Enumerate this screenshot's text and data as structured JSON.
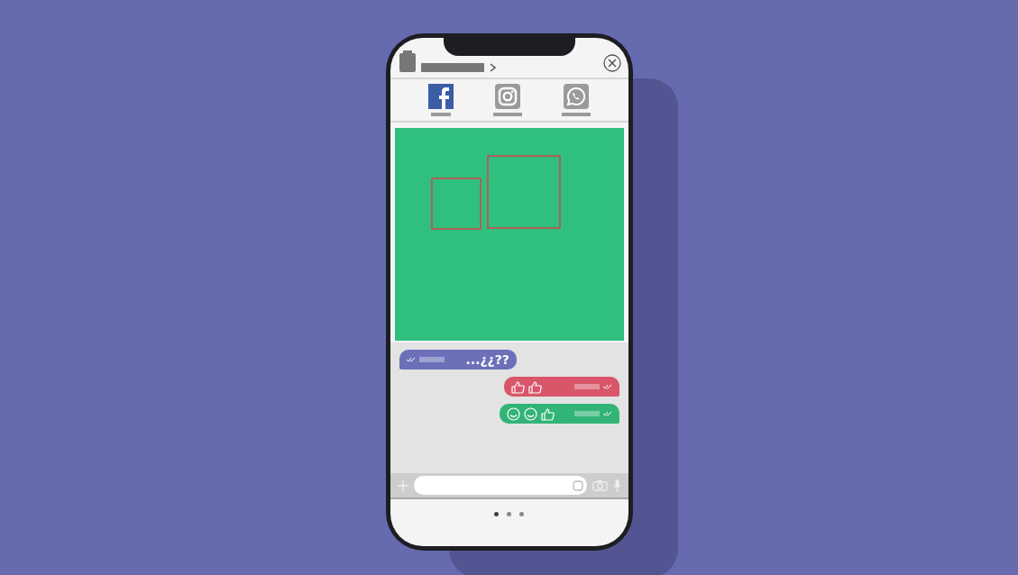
{
  "tabs": [
    {
      "kind": "facebook",
      "selected": true
    },
    {
      "kind": "instagram",
      "selected": false
    },
    {
      "kind": "whatsapp",
      "selected": false
    }
  ],
  "messages": [
    {
      "outgoing": false,
      "color": "#6b70b9",
      "kind": "text",
      "text": "...¿¿??"
    },
    {
      "outgoing": true,
      "color": "#d9566a",
      "kind": "emoji",
      "icons": [
        {
          "kind": "thumb"
        },
        {
          "kind": "thumb"
        }
      ]
    },
    {
      "outgoing": true,
      "color": "#33b477",
      "kind": "emoji",
      "icons": [
        {
          "kind": "smiley"
        },
        {
          "kind": "smiley"
        },
        {
          "kind": "thumb"
        }
      ]
    }
  ],
  "page_dots": [
    {
      "selected": true
    },
    {
      "selected": false
    },
    {
      "selected": false
    }
  ]
}
